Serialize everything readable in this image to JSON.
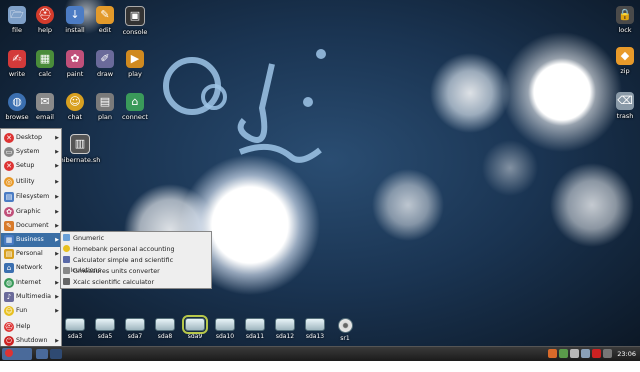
{
  "desktop": {
    "icons": [
      {
        "label": "file",
        "glyph": "🗁",
        "color": "#7fa0c8"
      },
      {
        "label": "help",
        "glyph": "⛑",
        "color": "#d43b2c"
      },
      {
        "label": "install",
        "glyph": "↓",
        "color": "#4c7cc4"
      },
      {
        "label": "edit",
        "glyph": "✎",
        "color": "#e39a2a"
      },
      {
        "label": "console",
        "glyph": "▣",
        "color": "#333333"
      },
      {
        "label": "write",
        "glyph": "✍",
        "color": "#d33a3a"
      },
      {
        "label": "calc",
        "glyph": "▦",
        "color": "#4a8c3a"
      },
      {
        "label": "paint",
        "glyph": "✿",
        "color": "#c0507a"
      },
      {
        "label": "draw",
        "glyph": "✐",
        "color": "#6a6a9a"
      },
      {
        "label": "play",
        "glyph": "▶",
        "color": "#d08a20"
      },
      {
        "label": "browse",
        "glyph": "◍",
        "color": "#3b6fb0"
      },
      {
        "label": "email",
        "glyph": "✉",
        "color": "#8a8a8a"
      },
      {
        "label": "chat",
        "glyph": "☺",
        "color": "#d8a020"
      },
      {
        "label": "plan",
        "glyph": "▤",
        "color": "#7a7a7a"
      },
      {
        "label": "connect",
        "glyph": "⌂",
        "color": "#3a9a5a"
      },
      {
        "label": "lock",
        "glyph": "🔒",
        "color": "#4a4a4a"
      },
      {
        "label": "zip",
        "glyph": "◆",
        "color": "#e89a2a"
      },
      {
        "label": "trash",
        "glyph": "⌫",
        "color": "#8a9aa8"
      },
      {
        "label": "hibernate.sh",
        "glyph": "▥",
        "color": "#555555"
      }
    ],
    "drives": [
      "sda3",
      "sda5",
      "sda7",
      "sda8",
      "sda9",
      "sda10",
      "sda11",
      "sda12",
      "sda13",
      "sr1"
    ],
    "selected_drive": "sda9"
  },
  "menu": {
    "items": [
      {
        "label": "Desktop",
        "color": "#d33"
      },
      {
        "label": "System",
        "color": "#888"
      },
      {
        "label": "Setup",
        "color": "#d33"
      },
      {
        "label": "Utility",
        "color": "#e89a2a"
      },
      {
        "label": "Filesystem",
        "color": "#4a7cc4"
      },
      {
        "label": "Graphic",
        "color": "#c0507a"
      },
      {
        "label": "Document",
        "color": "#d87a2a"
      },
      {
        "label": "Business",
        "color": "#4a7cc4"
      },
      {
        "label": "Personal",
        "color": "#d8a020"
      },
      {
        "label": "Network",
        "color": "#3b6fb0"
      },
      {
        "label": "Internet",
        "color": "#3a9a5a"
      },
      {
        "label": "Multimedia",
        "color": "#6a6a9a"
      },
      {
        "label": "Fun",
        "color": "#e8c020"
      },
      {
        "label": "Help",
        "color": "#d33"
      },
      {
        "label": "Shutdown",
        "color": "#c22"
      }
    ],
    "active": "Business",
    "submenu": [
      "Gnumeric",
      "Homebank personal accounting",
      "Calculator simple and scientific calculations",
      "Gmeasures units converter",
      "Xcalc scientific calculator"
    ]
  },
  "taskbar": {
    "menu_label": "Menu",
    "clock": "23:06"
  },
  "colors": {
    "accent": "#3a6ea5",
    "menu_bg": "#f0f0f0"
  }
}
